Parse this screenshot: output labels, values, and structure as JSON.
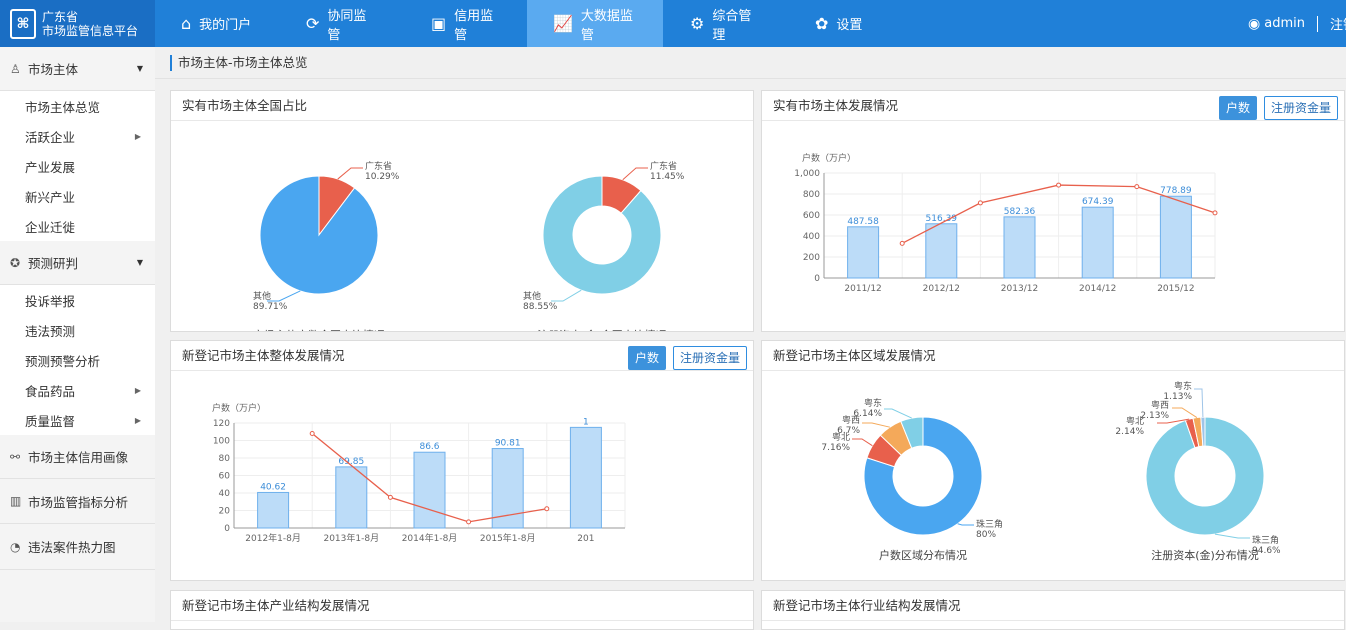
{
  "brand": {
    "line1": "广东省",
    "line2": "市场监管信息平台",
    "mark": "⌘"
  },
  "nav": [
    {
      "label": "我的门户",
      "icon": "home-icon"
    },
    {
      "label": "协同监管",
      "icon": "sync-icon"
    },
    {
      "label": "信用监管",
      "icon": "gauge-icon"
    },
    {
      "label": "大数据监管",
      "icon": "chart-icon"
    },
    {
      "label": "综合管理",
      "icon": "cogs-icon"
    },
    {
      "label": "设置",
      "icon": "gear-icon"
    }
  ],
  "user": {
    "name": "admin",
    "logout": "注销"
  },
  "sidebar": {
    "g1": "市场主体",
    "g1_items": [
      "市场主体总览",
      "活跃企业",
      "产业发展",
      "新兴产业",
      "企业迁徙"
    ],
    "g2": "预测研判",
    "g2_items": [
      "投诉举报",
      "违法预测",
      "预测预警分析",
      "食品药品",
      "质量监督"
    ],
    "g3": "市场主体信用画像",
    "g4": "市场监管指标分析",
    "g5": "违法案件热力图"
  },
  "breadcrumb": "市场主体-市场主体总览",
  "cards": {
    "c1": {
      "title": "实有市场主体全国占比",
      "pie1_caption": "市场主体户数全国占比情况",
      "pie2_caption": "注册资本(金)全国占比情况"
    },
    "c2": {
      "title": "实有市场主体发展情况",
      "btn_on": "户数",
      "btn_off": "注册资金量"
    },
    "c3": {
      "title": "新登记市场主体整体发展情况",
      "btn_on": "户数",
      "btn_off": "注册资金量"
    },
    "c4": {
      "title": "新登记市场主体区域发展情况",
      "donut1_caption": "户数区域分布情况",
      "donut2_caption": "注册资本(金)分布情况"
    },
    "c5": {
      "title": "新登记市场主体产业结构发展情况"
    },
    "c6": {
      "title": "新登记市场主体行业结构发展情况"
    }
  },
  "colors": {
    "blue": "#4aa6f0",
    "red": "#e8604c",
    "cyan": "#80cfe6",
    "orange": "#f4a95a",
    "bar": "#bcdcf8",
    "bar_edge": "#6fb0ec",
    "line": "#e8604c"
  },
  "chart_data": [
    {
      "type": "pie",
      "title": "市场主体户数全国占比情况",
      "slices": [
        {
          "name": "广东省",
          "value": 10.29
        },
        {
          "name": "其他",
          "value": 89.71
        }
      ]
    },
    {
      "type": "pie",
      "title": "注册资本(金)全国占比情况",
      "donut": true,
      "slices": [
        {
          "name": "广东省",
          "value": 11.45
        },
        {
          "name": "其他",
          "value": 88.55
        }
      ]
    },
    {
      "type": "bar",
      "title": "实有市场主体发展情况",
      "ylabel": "户数（万户）",
      "ylim": [
        0,
        1000
      ],
      "yticks": [
        "0",
        "200",
        "400",
        "600",
        "800",
        "1,000"
      ],
      "categories": [
        "2011/12",
        "2012/12",
        "2013/12",
        "2014/12",
        "2015/12"
      ],
      "values": [
        487.58,
        516.39,
        582.36,
        674.39,
        778.89
      ],
      "line": [
        null,
        330,
        715,
        885,
        870,
        620
      ]
    },
    {
      "type": "bar",
      "title": "新登记市场主体整体发展情况",
      "ylabel": "户数（万户）",
      "ylim": [
        0,
        120
      ],
      "yticks": [
        "0",
        "20",
        "40",
        "60",
        "80",
        "100",
        "120"
      ],
      "categories": [
        "2012年1-8月",
        "2013年1-8月",
        "2014年1-8月",
        "2015年1-8月",
        "201"
      ],
      "values": [
        40.62,
        69.85,
        86.6,
        90.81,
        115
      ],
      "labels": [
        "40.62",
        "69.85",
        "86.6",
        "90.81",
        "1"
      ],
      "line": [
        null,
        108,
        35,
        7,
        22
      ]
    },
    {
      "type": "pie",
      "title": "户数区域分布情况",
      "donut": true,
      "slices": [
        {
          "name": "珠三角",
          "value": 80
        },
        {
          "name": "粤北",
          "value": 7.16
        },
        {
          "name": "粤西",
          "value": 6.7
        },
        {
          "name": "粤东",
          "value": 6.14
        }
      ]
    },
    {
      "type": "pie",
      "title": "注册资本(金)分布情况",
      "donut": true,
      "slices": [
        {
          "name": "珠三角",
          "value": 94.6
        },
        {
          "name": "粤北",
          "value": 2.14
        },
        {
          "name": "粤西",
          "value": 2.13
        },
        {
          "name": "粤东",
          "value": 1.13
        }
      ]
    }
  ]
}
